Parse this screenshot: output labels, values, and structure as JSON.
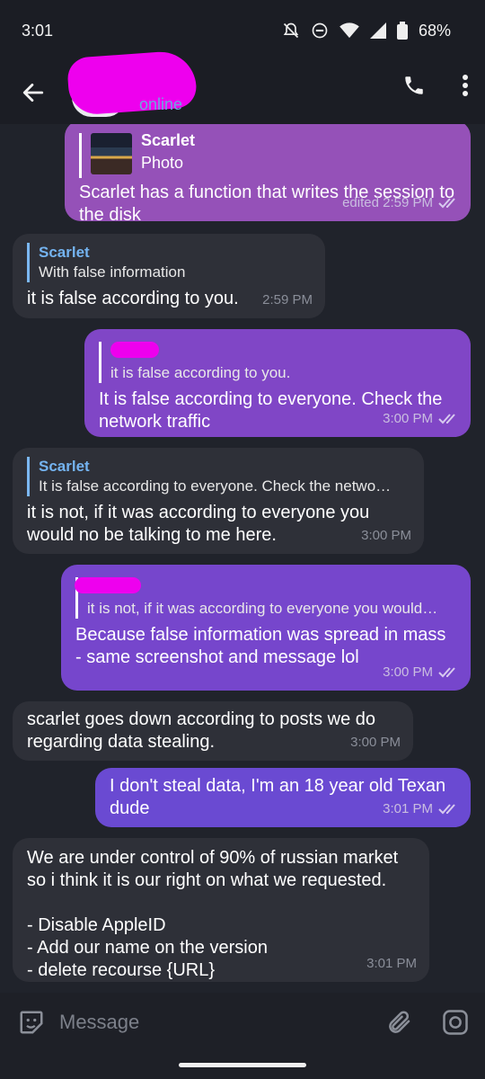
{
  "status_bar": {
    "time": "3:01",
    "battery": "68%"
  },
  "header": {
    "status": "online"
  },
  "messages": [
    {
      "dir": "out",
      "reply_name": "Scarlet",
      "reply_text": "Photo",
      "text": "Scarlet has a function that writes the session to the disk",
      "time": "edited 2:59 PM"
    },
    {
      "dir": "in",
      "reply_name": "Scarlet",
      "reply_text": "With false information",
      "text": "it is false according to you.",
      "time": "2:59 PM"
    },
    {
      "dir": "out",
      "reply_text": "it is false according to you.",
      "text": "It is false according to everyone. Check the network traffic",
      "time": "3:00 PM"
    },
    {
      "dir": "in",
      "reply_name": "Scarlet",
      "reply_text": "It is false according to everyone. Check the netwo…",
      "text": "it is not, if it was according to everyone you would no be talking to me here.",
      "time": "3:00 PM"
    },
    {
      "dir": "out",
      "reply_text": "it is not, if it was according to everyone you would…",
      "text": "Because false information was spread in mass - same screenshot and message lol",
      "time": "3:00 PM"
    },
    {
      "dir": "in",
      "text": "scarlet goes down according to posts we do regarding data stealing.",
      "time": "3:00 PM"
    },
    {
      "dir": "out",
      "text": "I don't steal data, I'm an 18 year old Texan dude",
      "time": "3:01 PM"
    },
    {
      "dir": "in",
      "text": "We are under control of 90% of russian market so i think it is our right on what we requested.\n\n- Disable AppleID\n- Add our name on the version\n- delete recourse {URL}",
      "time": "3:01 PM"
    }
  ],
  "composer": {
    "placeholder": "Message"
  }
}
